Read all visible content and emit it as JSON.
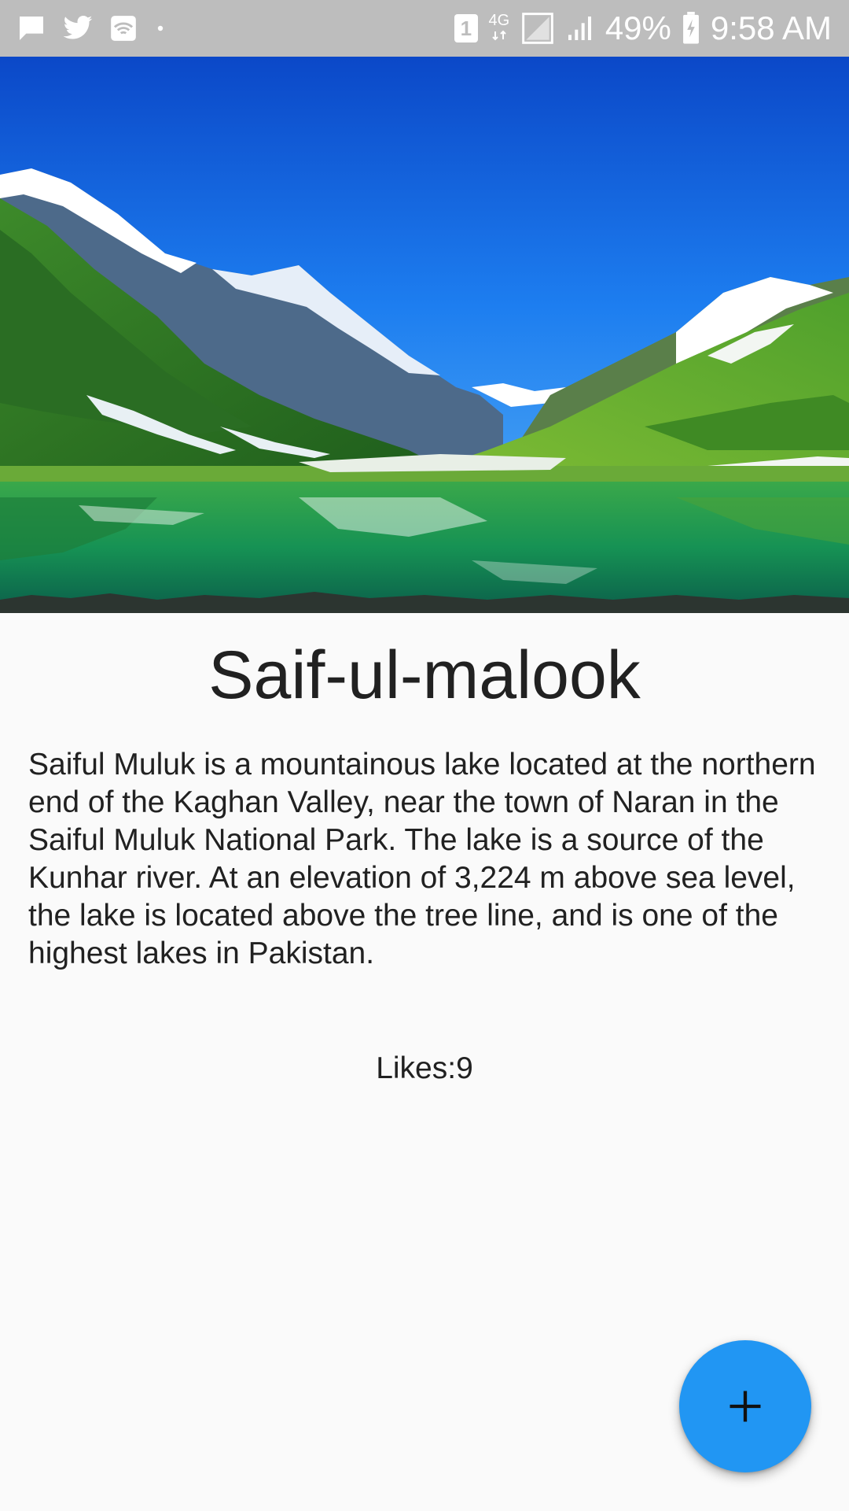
{
  "status_bar": {
    "icons_left": [
      "message-icon",
      "twitter-icon",
      "wifi-call-icon",
      "dot-icon"
    ],
    "sim_slot": "1",
    "network_type": "4G",
    "battery_percent": "49%",
    "time": "9:58 AM",
    "icons_right": [
      "sim-icon",
      "network-4g-icon",
      "signal-icon",
      "signal-icon",
      "battery-charging-icon"
    ]
  },
  "hero_image": {
    "subject": "mountain-lake-photo"
  },
  "place": {
    "title": "Saif-ul-malook",
    "description": "Saiful Muluk is a mountainous lake located at the northern end of the Kaghan Valley, near the town of Naran in the Saiful Muluk National Park. The lake is a source of the Kunhar river. At an elevation of 3,224 m above sea level, the lake is located above the tree line, and is one of the highest lakes in Pakistan.",
    "likes_text": "Likes:9"
  },
  "fab": {
    "icon": "plus-icon"
  },
  "colors": {
    "status_bar": "#bdbdbd",
    "background": "#fafafa",
    "fab": "#2196f3",
    "text": "#212121"
  }
}
